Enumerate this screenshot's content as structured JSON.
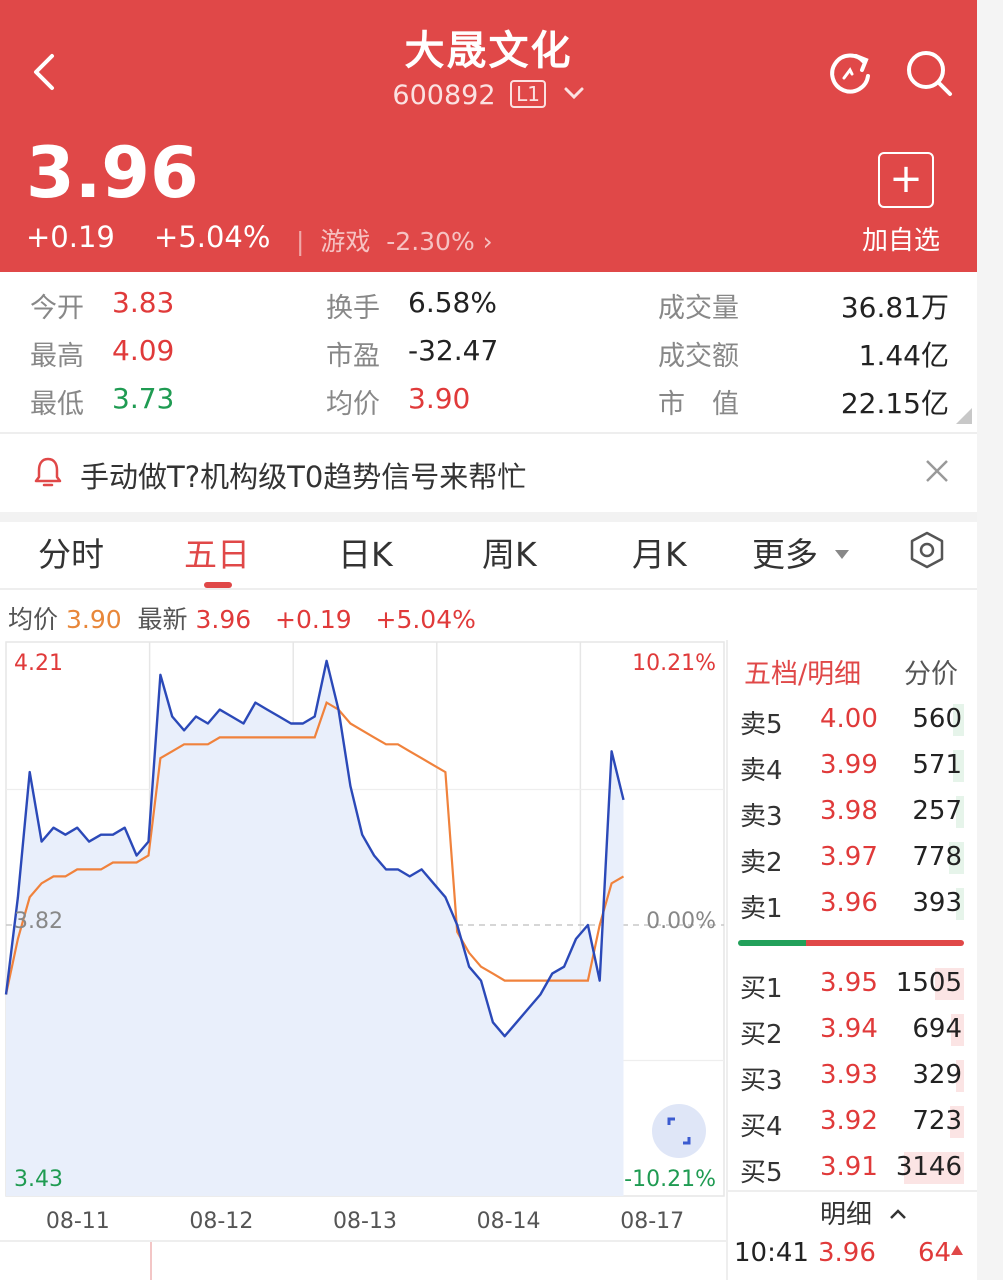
{
  "header": {
    "stock_name": "大晟文化",
    "stock_code": "600892",
    "level_badge": "L1",
    "price": "3.96",
    "change": "+0.19",
    "change_pct": "+5.04%",
    "sector_name": "游戏",
    "sector_change": "-2.30%",
    "add_watch_label": "加自选",
    "icons": [
      "back-chevron-icon",
      "refresh-icon",
      "search-icon",
      "plus-icon"
    ]
  },
  "stats": [
    {
      "label": "今开",
      "value": "3.83",
      "color": "red"
    },
    {
      "label": "最高",
      "value": "4.09",
      "color": "red"
    },
    {
      "label": "最低",
      "value": "3.73",
      "color": "green"
    },
    {
      "label": "换手",
      "value": "6.58%",
      "color": "dark"
    },
    {
      "label": "市盈",
      "value": "-32.47",
      "color": "dark"
    },
    {
      "label": "均价",
      "value": "3.90",
      "color": "red"
    },
    {
      "label": "成交量",
      "value": "36.81万",
      "color": "dark"
    },
    {
      "label": "成交额",
      "value": "1.44亿",
      "color": "dark"
    },
    {
      "label": "市　值",
      "value": "22.15亿",
      "color": "dark"
    }
  ],
  "notice": {
    "text": "手动做T?机构级T0趋势信号来帮忙",
    "icons": [
      "bell-icon",
      "close-icon"
    ]
  },
  "tabs": [
    "分时",
    "五日",
    "日K",
    "周K",
    "月K",
    "更多"
  ],
  "active_tab": "五日",
  "summary": {
    "avg_label": "均价",
    "avg_value": "3.90",
    "latest_label": "最新",
    "latest_value": "3.96",
    "change": "+0.19",
    "change_pct": "+5.04%"
  },
  "chart_data": {
    "type": "line",
    "x": [
      "08-11",
      "08-12",
      "08-13",
      "08-14",
      "08-17"
    ],
    "ylim": [
      3.43,
      4.21
    ],
    "y_ticks_left": [
      "4.21",
      "3.82",
      "3.43"
    ],
    "y_ticks_right": [
      "10.21%",
      "0.00%",
      "-10.21%"
    ],
    "series": [
      {
        "role": "price",
        "color": "#2b49b8",
        "values": [
          3.72,
          3.86,
          4.04,
          3.94,
          3.96,
          3.95,
          3.96,
          3.94,
          3.95,
          3.95,
          3.96,
          3.92,
          3.94,
          4.18,
          4.12,
          4.1,
          4.12,
          4.11,
          4.13,
          4.12,
          4.11,
          4.14,
          4.13,
          4.12,
          4.11,
          4.11,
          4.12,
          4.2,
          4.13,
          4.02,
          3.95,
          3.92,
          3.9,
          3.9,
          3.89,
          3.9,
          3.88,
          3.86,
          3.82,
          3.76,
          3.74,
          3.68,
          3.66,
          3.68,
          3.7,
          3.72,
          3.75,
          3.76,
          3.8,
          3.82,
          3.74,
          4.07,
          4.0
        ]
      },
      {
        "role": "average",
        "color": "#f0823c",
        "values": [
          3.72,
          3.8,
          3.86,
          3.88,
          3.89,
          3.89,
          3.9,
          3.9,
          3.9,
          3.91,
          3.91,
          3.91,
          3.92,
          4.06,
          4.07,
          4.08,
          4.08,
          4.08,
          4.09,
          4.09,
          4.09,
          4.09,
          4.09,
          4.09,
          4.09,
          4.09,
          4.09,
          4.14,
          4.13,
          4.11,
          4.1,
          4.09,
          4.08,
          4.08,
          4.07,
          4.06,
          4.05,
          4.04,
          3.81,
          3.78,
          3.76,
          3.75,
          3.74,
          3.74,
          3.74,
          3.74,
          3.74,
          3.74,
          3.74,
          3.74,
          3.82,
          3.88,
          3.89
        ]
      }
    ]
  },
  "orderbook": {
    "title": "五档/明细",
    "alt_tab": "分价",
    "asks": [
      {
        "label": "卖5",
        "price": "4.00",
        "volume": "560",
        "vol_frac": 0.18
      },
      {
        "label": "卖4",
        "price": "3.99",
        "volume": "571",
        "vol_frac": 0.18
      },
      {
        "label": "卖3",
        "price": "3.98",
        "volume": "257",
        "vol_frac": 0.08
      },
      {
        "label": "卖2",
        "price": "3.97",
        "volume": "778",
        "vol_frac": 0.25
      },
      {
        "label": "卖1",
        "price": "3.96",
        "volume": "393",
        "vol_frac": 0.12
      }
    ],
    "bids": [
      {
        "label": "买1",
        "price": "3.95",
        "volume": "1505",
        "vol_frac": 0.48
      },
      {
        "label": "买2",
        "price": "3.94",
        "volume": "694",
        "vol_frac": 0.22
      },
      {
        "label": "买3",
        "price": "3.93",
        "volume": "329",
        "vol_frac": 0.1
      },
      {
        "label": "买4",
        "price": "3.92",
        "volume": "723",
        "vol_frac": 0.23
      },
      {
        "label": "买5",
        "price": "3.91",
        "volume": "3146",
        "vol_frac": 1.0
      }
    ],
    "detail_label": "明细",
    "trade": {
      "time": "10:41",
      "price": "3.96",
      "volume": "64"
    },
    "colors": {
      "ask_bar": "#e6f4ea",
      "bid_bar": "#fbe4e4",
      "bar_green": "#22a05a",
      "bar_red": "#e04848"
    }
  }
}
